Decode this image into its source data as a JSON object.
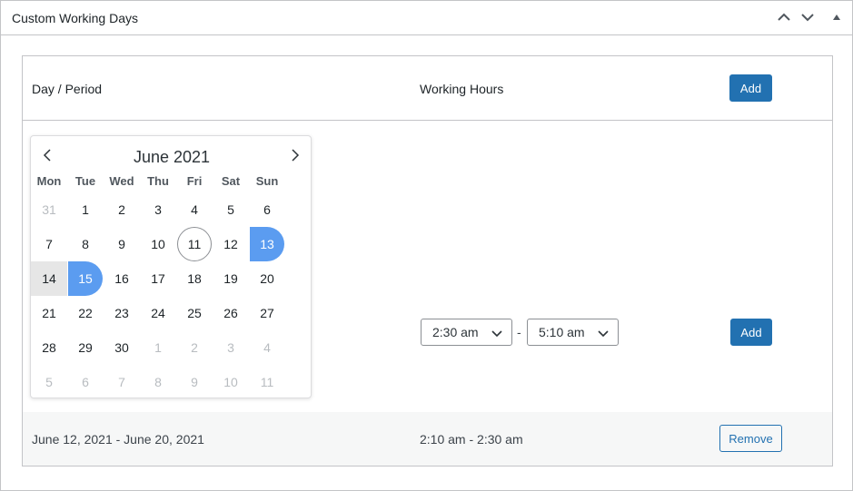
{
  "panel": {
    "title": "Custom Working Days"
  },
  "table": {
    "headers": {
      "day_period": "Day / Period",
      "working_hours": "Working Hours",
      "add_label": "Add"
    },
    "edit_row": {
      "start_time": "2:30 am",
      "end_time": "5:10 am",
      "separator": "-",
      "add_label": "Add"
    },
    "rows": [
      {
        "period": "June 12, 2021 - June 20, 2021",
        "hours": "2:10 am - 2:30 am",
        "remove_label": "Remove"
      }
    ]
  },
  "datepicker": {
    "month_label": "June 2021",
    "weekdays": [
      "Mon",
      "Tue",
      "Wed",
      "Thu",
      "Fri",
      "Sat",
      "Sun"
    ],
    "weeks": [
      [
        "31",
        "1",
        "2",
        "3",
        "4",
        "5",
        "6"
      ],
      [
        "7",
        "8",
        "9",
        "10",
        "11",
        "12",
        "13"
      ],
      [
        "14",
        "15",
        "16",
        "17",
        "18",
        "19",
        "20"
      ],
      [
        "21",
        "22",
        "23",
        "24",
        "25",
        "26",
        "27"
      ],
      [
        "28",
        "29",
        "30",
        "1",
        "2",
        "3",
        "4"
      ],
      [
        "5",
        "6",
        "7",
        "8",
        "9",
        "10",
        "11"
      ]
    ],
    "other_month": [
      [
        0,
        0
      ],
      [
        4,
        3
      ],
      [
        4,
        4
      ],
      [
        4,
        5
      ],
      [
        4,
        6
      ],
      [
        5,
        0
      ],
      [
        5,
        1
      ],
      [
        5,
        2
      ],
      [
        5,
        3
      ],
      [
        5,
        4
      ],
      [
        5,
        5
      ],
      [
        5,
        6
      ]
    ],
    "selected_start": [
      1,
      6
    ],
    "selected_end": [
      2,
      1
    ],
    "in_range": [
      [
        2,
        0
      ]
    ],
    "today": [
      1,
      4
    ],
    "accent_color": "#5b9cf0"
  },
  "colors": {
    "primary": "#2271b1",
    "border": "#c3c4c7"
  },
  "icons": {
    "collapse_up": "chevron-up-icon",
    "collapse_down": "chevron-down-icon",
    "toggle": "caret-up-icon",
    "prev_month": "chevron-left-icon",
    "next_month": "chevron-right-icon",
    "select_arrow": "chevron-down-icon"
  }
}
